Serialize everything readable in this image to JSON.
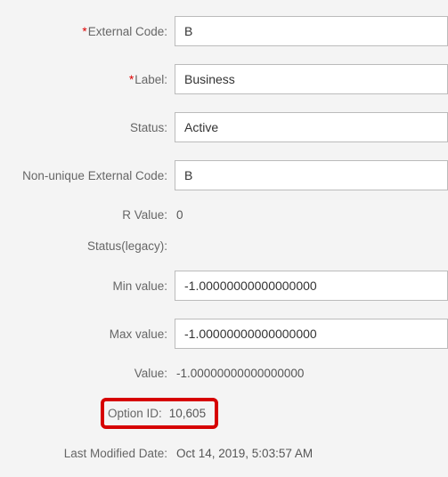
{
  "fields": {
    "externalCode": {
      "label": "External Code:",
      "value": "B",
      "required": true
    },
    "label": {
      "label": "Label:",
      "value": "Business",
      "required": true
    },
    "status": {
      "label": "Status:",
      "value": "Active",
      "required": false
    },
    "nonUniqueExternalCode": {
      "label": "Non-unique External Code:",
      "value": "B",
      "required": false
    },
    "rValue": {
      "label": "R Value:",
      "value": "0"
    },
    "statusLegacy": {
      "label": "Status(legacy):",
      "value": ""
    },
    "minValue": {
      "label": "Min value:",
      "value": "-1.00000000000000000"
    },
    "maxValue": {
      "label": "Max value:",
      "value": "-1.00000000000000000"
    },
    "value": {
      "label": "Value:",
      "value": "-1.00000000000000000"
    },
    "optionId": {
      "label": "Option ID:",
      "value": "10,605"
    },
    "lastModifiedDate": {
      "label": "Last Modified Date:",
      "value": "Oct 14, 2019, 5:03:57 AM"
    }
  },
  "requiredMark": "*"
}
